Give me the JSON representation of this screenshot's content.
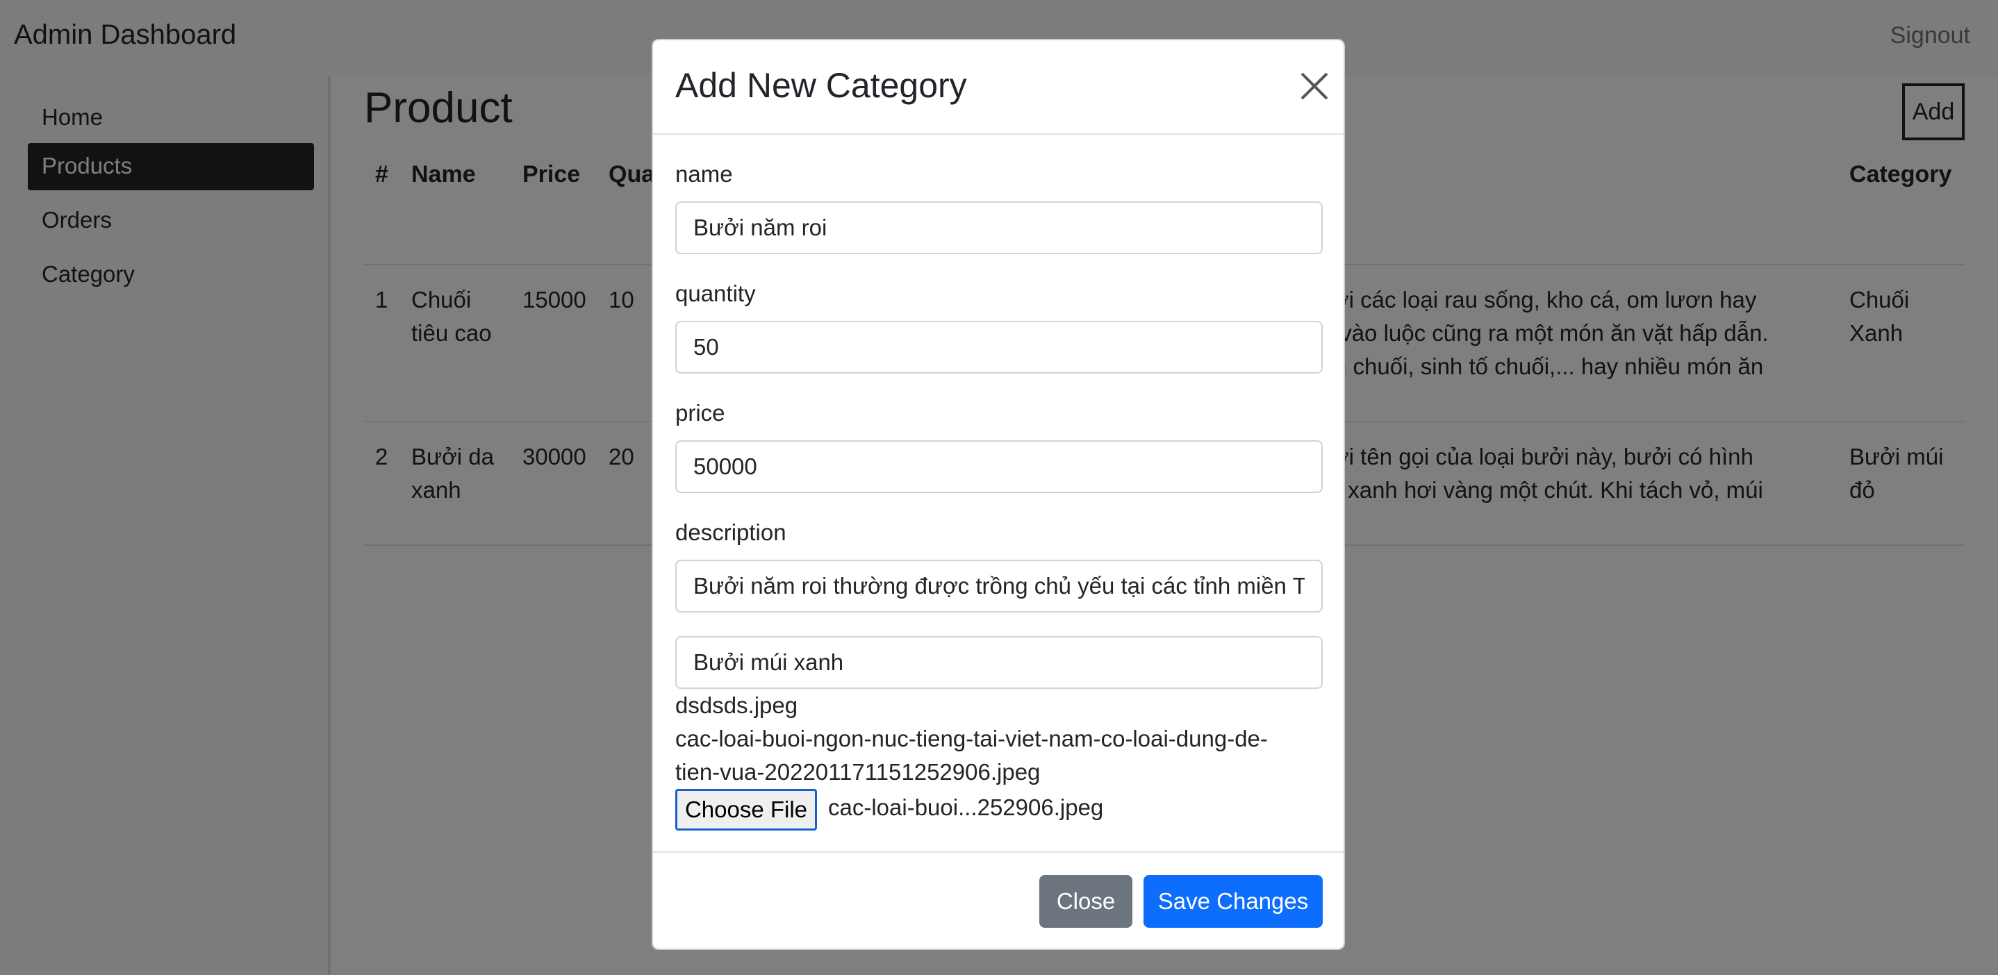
{
  "navbar": {
    "brand": "Admin Dashboard",
    "signout": "Signout"
  },
  "sidebar": {
    "items": [
      {
        "label": "Home"
      },
      {
        "label": "Products"
      },
      {
        "label": "Orders"
      },
      {
        "label": "Category"
      }
    ]
  },
  "main": {
    "title": "Product",
    "add_label": "Add",
    "columns": [
      "#",
      "Name",
      "Price",
      "Qua",
      "Category"
    ],
    "rows": [
      {
        "id": "1",
        "name_line1": "Chuối",
        "name_line2": "tiêu cao",
        "price": "15000",
        "qty": "10",
        "desc_line1": "g với các loại rau sống, kho cá, om lươn hay",
        "desc_line2": "iêu vào luộc cũng ra một món ăn vặt hấp dẫn.",
        "desc_line3": "kem chuối, sinh tố chuối,... hay nhiều món ăn",
        "cat_line1": "Chuối",
        "cat_line2": "Xanh"
      },
      {
        "id": "2",
        "name_line1": "Bưởi da",
        "name_line2": "xanh",
        "price": "30000",
        "qty": "20",
        "desc_line1": "g với tên gọi của loại bưởi này, bưởi có hình",
        "desc_line2": "ang xanh hơi vàng một chút. Khi tách vỏ, múi",
        "cat_line1": "Bưởi múi",
        "cat_line2": "đỏ"
      }
    ]
  },
  "modal": {
    "title": "Add New Category",
    "fields": {
      "name_label": "name",
      "name_value": "Bưởi năm roi",
      "quantity_label": "quantity",
      "quantity_value": "50",
      "price_label": "price",
      "price_value": "50000",
      "description_label": "description",
      "description_value": "Bưởi năm roi thường được trồng chủ yếu tại các tỉnh miền Tây",
      "category_value": "Bưởi múi xanh"
    },
    "files": {
      "file1": "dsdsds.jpeg",
      "file2_line1": "cac-loai-buoi-ngon-nuc-tieng-tai-viet-nam-co-loai-dung-de-",
      "file2_line2": "tien-vua-20220117115125290​6.jpeg",
      "choose_label": "Choose File",
      "chosen_name": "cac-loai-buoi...252906.jpeg"
    },
    "close_label": "Close",
    "save_label": "Save Changes"
  }
}
